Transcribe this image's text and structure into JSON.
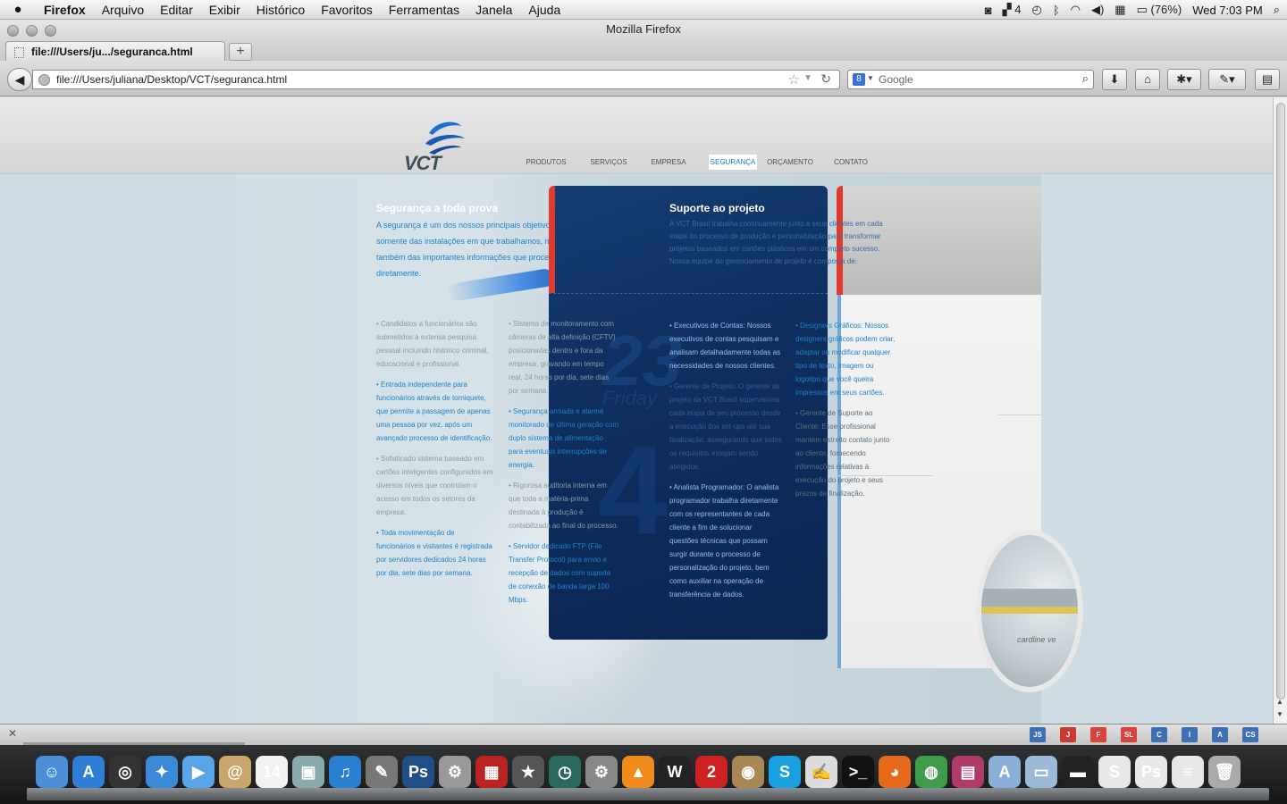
{
  "menubar": {
    "apple": "",
    "items": [
      "Firefox",
      "Arquivo",
      "Editar",
      "Exibir",
      "Histórico",
      "Favoritos",
      "Ferramentas",
      "Janela",
      "Ajuda"
    ],
    "adobe_count": "4",
    "battery": "(76%)",
    "clock": "Wed 7:03 PM"
  },
  "window": {
    "title": "Mozilla Firefox"
  },
  "tab": {
    "label": "file:///Users/ju.../seguranca.html",
    "new_tab": "+"
  },
  "navbar": {
    "url": "file:///Users/juliana/Desktop/VCT/seguranca.html",
    "search_engine": "8",
    "search_placeholder": "Google"
  },
  "site": {
    "logo_text": "VCT",
    "nav": [
      "PRODUTOS",
      "SERVIÇOS",
      "EMPRESA",
      "SEGURANÇA",
      "ORÇAMENTO",
      "CONTATO"
    ],
    "active_nav": "SEGURANÇA",
    "left_heading": "Segurança a toda prova",
    "left_intro": "A segurança é um dos nossos principais objetivos, não somente das instalações em que trabalhamos, mas também das importantes informações que processamos diretamente.",
    "col1": [
      {
        "text": "• Candidatos a funcionários são submetidos à extensa pesquisa pessoal incluindo histórico criminal, educacional e profissional.",
        "tone": "gray"
      },
      {
        "text": "• Entrada independente para funcionários através de torniquete, que permite a passagem de apenas uma pessoa por vez, após um avançado processo de identificação.",
        "tone": "blue"
      },
      {
        "text": "• Sofisticado sistema baseado em cartões inteligentes configurados em diversos níveis que controlam o acesso em todos os setores da empresa.",
        "tone": "gray"
      },
      {
        "text": "• Toda movimentação de funcionários e visitantes é registrada por servidores dedicados 24 horas por dia, sete dias por semana.",
        "tone": "blue"
      }
    ],
    "col2": [
      {
        "text": "• Sistema de monitoramento com câmeras de alta definição (CFTV) posicionadas dentro e fora da empresa, gravando em tempo real, 24 horas por dia, sete dias por semana.",
        "tone": "gray"
      },
      {
        "text": "• Segurança armada e alarme monitorado de última geração com duplo sistema de alimentação para eventuais interrupções de energia.",
        "tone": "blue"
      },
      {
        "text": "• Rigorosa auditoria interna em que toda a matéria-prima destinada à produção é contabilizada ao final do processo.",
        "tone": "gray"
      },
      {
        "text": "• Servidor dedicado FTP (File Transfer Protocol) para envio e recepção de dados com suporte de conexão de banda larga 100 Mbps.",
        "tone": "blue"
      }
    ],
    "center_heading": "Suporte ao projeto",
    "center_intro": "A VCT Brasil trabalha continuamente junto a seus clientes em cada etapa do processo de produção e personalização para transformar projetos baseados em cartões plásticos em um completo sucesso. Nossa equipe de gerenciamento de projeto é composta de:",
    "decor_number": "23",
    "decor_day": "Friday",
    "decor_number2": "4",
    "col3": [
      {
        "text": "• Executivos de Contas: Nossos executivos de contas pesquisam e analisam detalhadamente todas as necessidades de nossos clientes.",
        "tone": "light"
      },
      {
        "text": "• Gerente de Projeto: O gerente de projeto da VCT Brasil supervisiona cada etapa de seu processo desde a execução dos set-ups até sua finalização, assegurando que todos os requisitos estejam sendo atingidos.",
        "tone": "dim"
      },
      {
        "text": "• Analista Programador: O analista programador trabalha diretamente com os representantes de cada cliente a fim de solucionar questões técnicas que possam surgir durante o processo de personalização do projeto, bem como auxiliar na operação de transferência de dados.",
        "tone": "light"
      }
    ],
    "col4": [
      {
        "text": "• Designers Gráficos: Nossos designers gráficos podem criar, adaptar ou modificar qualquer tipo de texto, imagem ou logotipo que você queira impressos em seus cartões.",
        "tone": "blue"
      },
      {
        "text": "• Gerente de Suporte ao Cliente: Esse profissional mantém estreito contato junto ao cliente, fornecendo informações relativas à execução do projeto e seus prazos de finalização.",
        "tone": "mixed"
      }
    ],
    "photo_label": "cardline ve"
  },
  "addon_buttons": [
    {
      "label": "JS",
      "color": "#3f6fb5"
    },
    {
      "label": "J",
      "color": "#c83a32"
    },
    {
      "label": "F",
      "color": "#d8433b"
    },
    {
      "label": "SL",
      "color": "#d8433b"
    },
    {
      "label": "C",
      "color": "#3f6fb5"
    },
    {
      "label": "I",
      "color": "#3f6fb5"
    },
    {
      "label": "A",
      "color": "#3f6fb5"
    },
    {
      "label": "CS",
      "color": "#3f6fb5"
    }
  ],
  "dock": [
    {
      "icon": "finder-icon",
      "glyph": "☺",
      "color": "#4a8fd8"
    },
    {
      "icon": "app-store-icon",
      "glyph": "A",
      "color": "#2e7dd6"
    },
    {
      "icon": "dashboard-icon",
      "glyph": "◎",
      "color": "#333"
    },
    {
      "icon": "safari-icon",
      "glyph": "✦",
      "color": "#3a8ad8"
    },
    {
      "icon": "facetime-icon",
      "glyph": "▶",
      "color": "#58a6e8"
    },
    {
      "icon": "contacts-icon",
      "glyph": "@",
      "color": "#c9a66b"
    },
    {
      "icon": "calendar-icon",
      "glyph": "14",
      "color": "#f2f2f2"
    },
    {
      "icon": "photos-icon",
      "glyph": "▣",
      "color": "#8aa"
    },
    {
      "icon": "itunes-icon",
      "glyph": "♫",
      "color": "#2a7fd0"
    },
    {
      "icon": "gimp-icon",
      "glyph": "✎",
      "color": "#777"
    },
    {
      "icon": "photoshop-icon",
      "glyph": "Ps",
      "color": "#1f4f86"
    },
    {
      "icon": "preview-icon",
      "glyph": "⚙",
      "color": "#999"
    },
    {
      "icon": "photo-booth-icon",
      "glyph": "▦",
      "color": "#b22"
    },
    {
      "icon": "imovie-icon",
      "glyph": "★",
      "color": "#555"
    },
    {
      "icon": "time-machine-icon",
      "glyph": "◷",
      "color": "#2a6a5e"
    },
    {
      "icon": "system-prefs-icon",
      "glyph": "⚙",
      "color": "#888"
    },
    {
      "icon": "vlc-icon",
      "glyph": "▲",
      "color": "#f08a1a"
    },
    {
      "icon": "console-icon",
      "glyph": "W",
      "color": "#222"
    },
    {
      "icon": "filezilla-icon",
      "glyph": "2",
      "color": "#c22"
    },
    {
      "icon": "image-capture-icon",
      "glyph": "◉",
      "color": "#a85"
    },
    {
      "icon": "skype-icon",
      "glyph": "S",
      "color": "#18a0e0"
    },
    {
      "icon": "textedit-icon",
      "glyph": "✍",
      "color": "#ddd"
    },
    {
      "icon": "terminal-icon",
      "glyph": ">_",
      "color": "#111"
    },
    {
      "icon": "firefox-icon",
      "glyph": "◕",
      "color": "#e56a1c"
    },
    {
      "icon": "chrome-icon",
      "glyph": "◍",
      "color": "#3d9b4a"
    },
    {
      "icon": "stack-icon",
      "glyph": "▤",
      "color": "#b03a6a"
    },
    {
      "icon": "applications-folder-icon",
      "glyph": "A",
      "color": "#8ab0d8"
    },
    {
      "icon": "documents-folder-icon",
      "glyph": "▭",
      "color": "#9cbad8"
    },
    {
      "icon": "window-stack-icon",
      "glyph": "▬",
      "color": "#222"
    },
    {
      "icon": "skype-file-icon",
      "glyph": "S",
      "color": "#e8e8e8"
    },
    {
      "icon": "ps-file-icon",
      "glyph": "Ps",
      "color": "#e8e8e8"
    },
    {
      "icon": "web-file-icon",
      "glyph": "≡",
      "color": "#e8e8e8"
    },
    {
      "icon": "trash-icon",
      "glyph": "🗑",
      "color": "#aaa"
    }
  ]
}
